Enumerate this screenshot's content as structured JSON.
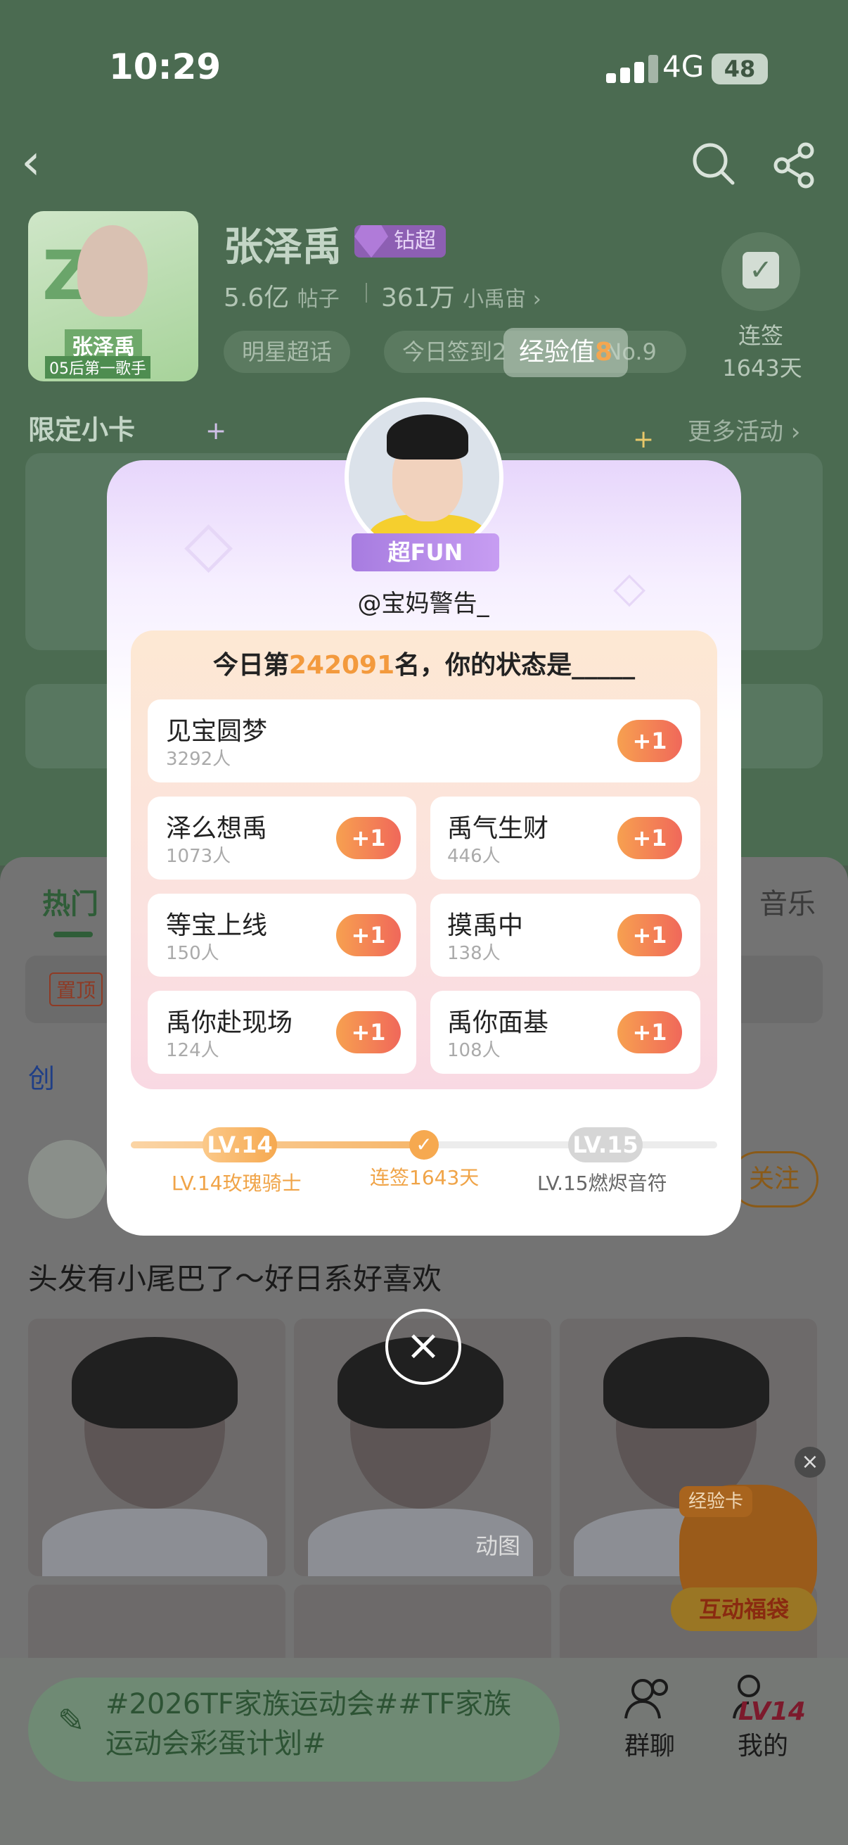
{
  "status": {
    "time": "10:29",
    "network": "4G",
    "battery": "48"
  },
  "star": {
    "name": "张泽禹",
    "badge": "钻超",
    "posts_value": "5.6亿",
    "posts_label": "帖子",
    "fans_value": "361万",
    "fans_label": "小禹宙",
    "tag1": "明星超话",
    "tag2": "今日签到2",
    "tag2_tail": "No.9",
    "checkin_label": "连签",
    "checkin_days": "1643天",
    "exp_toast": "经验值",
    "exp_value": "8",
    "cover_title": "张泽禹",
    "cover_sub": "05后第一歌手"
  },
  "section": {
    "limited_cards": "限定小卡",
    "more_activities": "更多活动"
  },
  "feed": {
    "tab_hot": "热门",
    "tab_music": "音乐",
    "pinned": "置顶",
    "creator_row": "创",
    "follow": "关注",
    "post_title": "头发有小尾巴了～好日系好喜欢",
    "gif_label": "动图",
    "exp_card": "经验卡",
    "lucky_bag": "互动福袋"
  },
  "bottom": {
    "input_text": "#2026TF家族运动会##TF家族运动会彩蛋计划#",
    "group_chat": "群聊",
    "mine": "我的",
    "level_tag": "LV14"
  },
  "modal": {
    "badge": "超FUN",
    "username": "@宝妈警告_",
    "rank_prefix": "今日第",
    "rank_number": "242091",
    "rank_suffix": "名，你的状态是_____",
    "plus_label": "+1",
    "options": [
      {
        "name": "见宝圆梦",
        "count": "3292人"
      },
      {
        "name": "泽么想禹",
        "count": "1073人"
      },
      {
        "name": "禹气生财",
        "count": "446人"
      },
      {
        "name": "等宝上线",
        "count": "150人"
      },
      {
        "name": "摸禹中",
        "count": "138人"
      },
      {
        "name": "禹你赴现场",
        "count": "124人"
      },
      {
        "name": "禹你面基",
        "count": "108人"
      }
    ],
    "level_current": "LV.14",
    "level_next": "LV.15",
    "level_current_name": "LV.14玫瑰骑士",
    "streak": "连签1643天",
    "level_next_name": "LV.15燃烬音符",
    "progress": 0.5
  },
  "colors": {
    "accent_green": "#2f5d38",
    "accent_orange": "#f39a3d",
    "purple": "#a77ce0"
  },
  "icons": [
    "back-icon",
    "search-icon",
    "share-icon",
    "calendar-check-icon",
    "diamond-icon",
    "close-icon",
    "pen-icon",
    "group-chat-icon",
    "profile-icon"
  ]
}
